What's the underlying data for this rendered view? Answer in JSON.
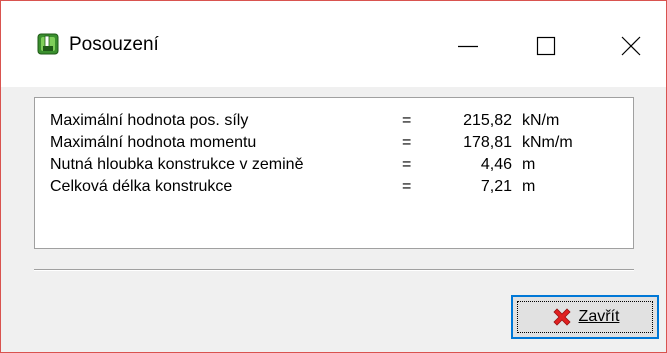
{
  "window": {
    "title": "Posouzení"
  },
  "results": [
    {
      "label": "Maximální hodnota pos. síly",
      "eq": "=",
      "value": "215,82",
      "unit": "kN/m"
    },
    {
      "label": "Maximální hodnota momentu",
      "eq": "=",
      "value": "178,81",
      "unit": "kNm/m"
    },
    {
      "label": "Nutná hloubka konstrukce v zemině",
      "eq": "=",
      "value": "4,46",
      "unit": "m"
    },
    {
      "label": "Celková délka konstrukce",
      "eq": "=",
      "value": "7,21",
      "unit": "m"
    }
  ],
  "buttons": {
    "close_label": "Zavřít"
  },
  "icons": {
    "app": "app-icon",
    "minimize": "minimize-icon",
    "maximize": "maximize-icon",
    "close": "close-icon",
    "button_close": "red-x-icon"
  },
  "colors": {
    "window_border": "#d9534f",
    "accent": "#0078d7",
    "x_red": "#e02020"
  }
}
